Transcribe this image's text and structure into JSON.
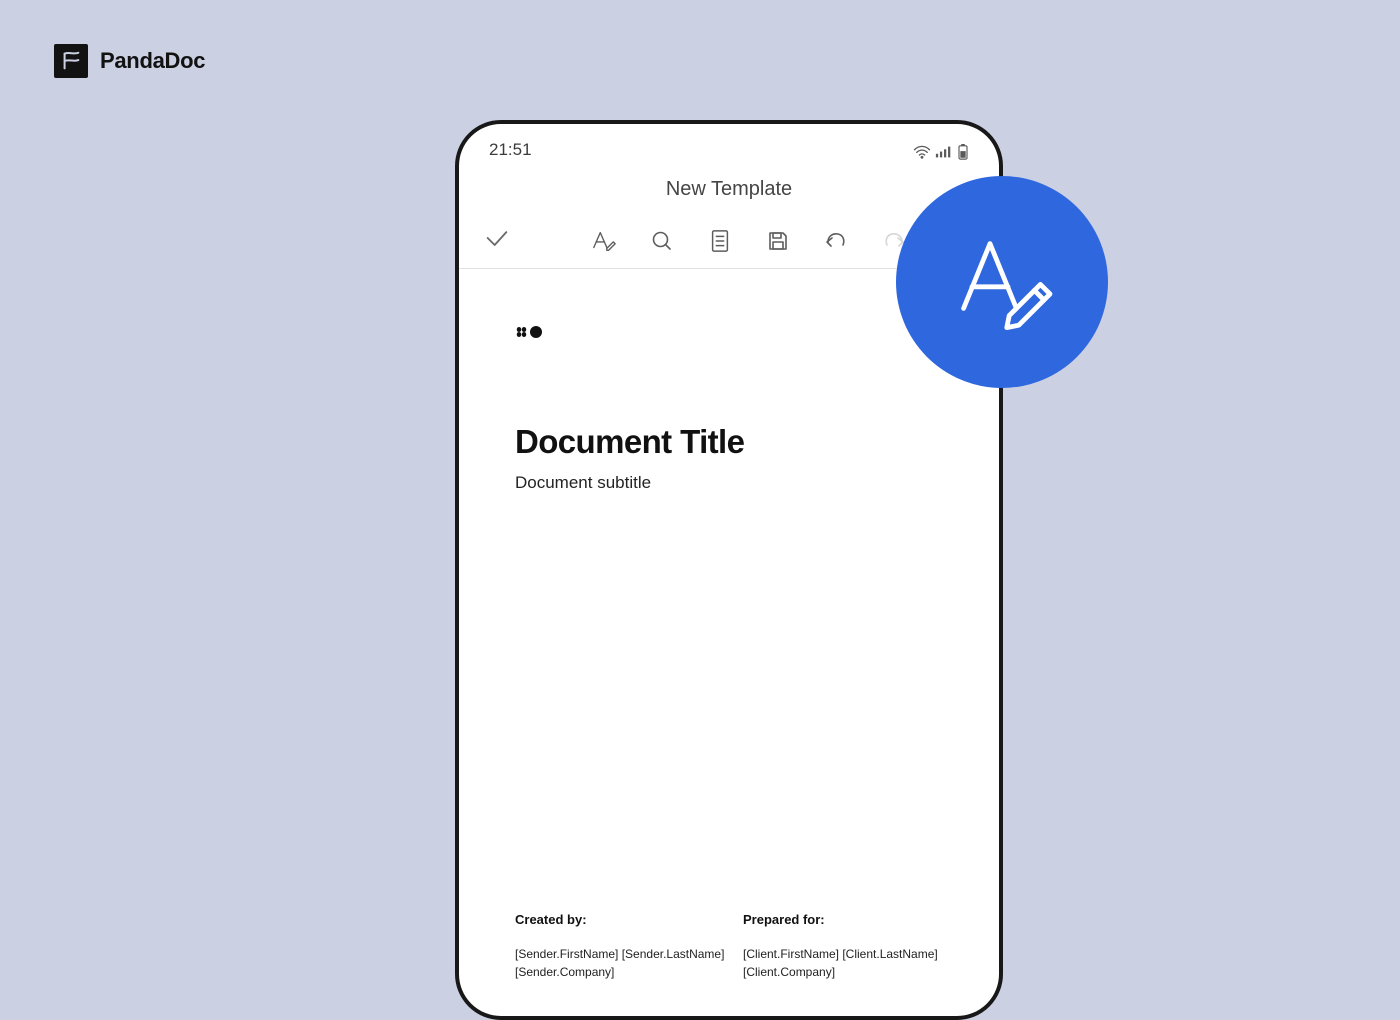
{
  "brand": {
    "name": "PandaDoc"
  },
  "status": {
    "time": "21:51"
  },
  "page": {
    "title": "New Template"
  },
  "document": {
    "title": "Document Title",
    "subtitle": "Document subtitle",
    "created_by_label": "Created by:",
    "prepared_for_label": "Prepared for:",
    "sender_name": "[Sender.FirstName] [Sender.LastName]",
    "sender_company": "[Sender.Company]",
    "client_name": "[Client.FirstName] [Client.LastName]",
    "client_company": "[Client.Company]"
  }
}
